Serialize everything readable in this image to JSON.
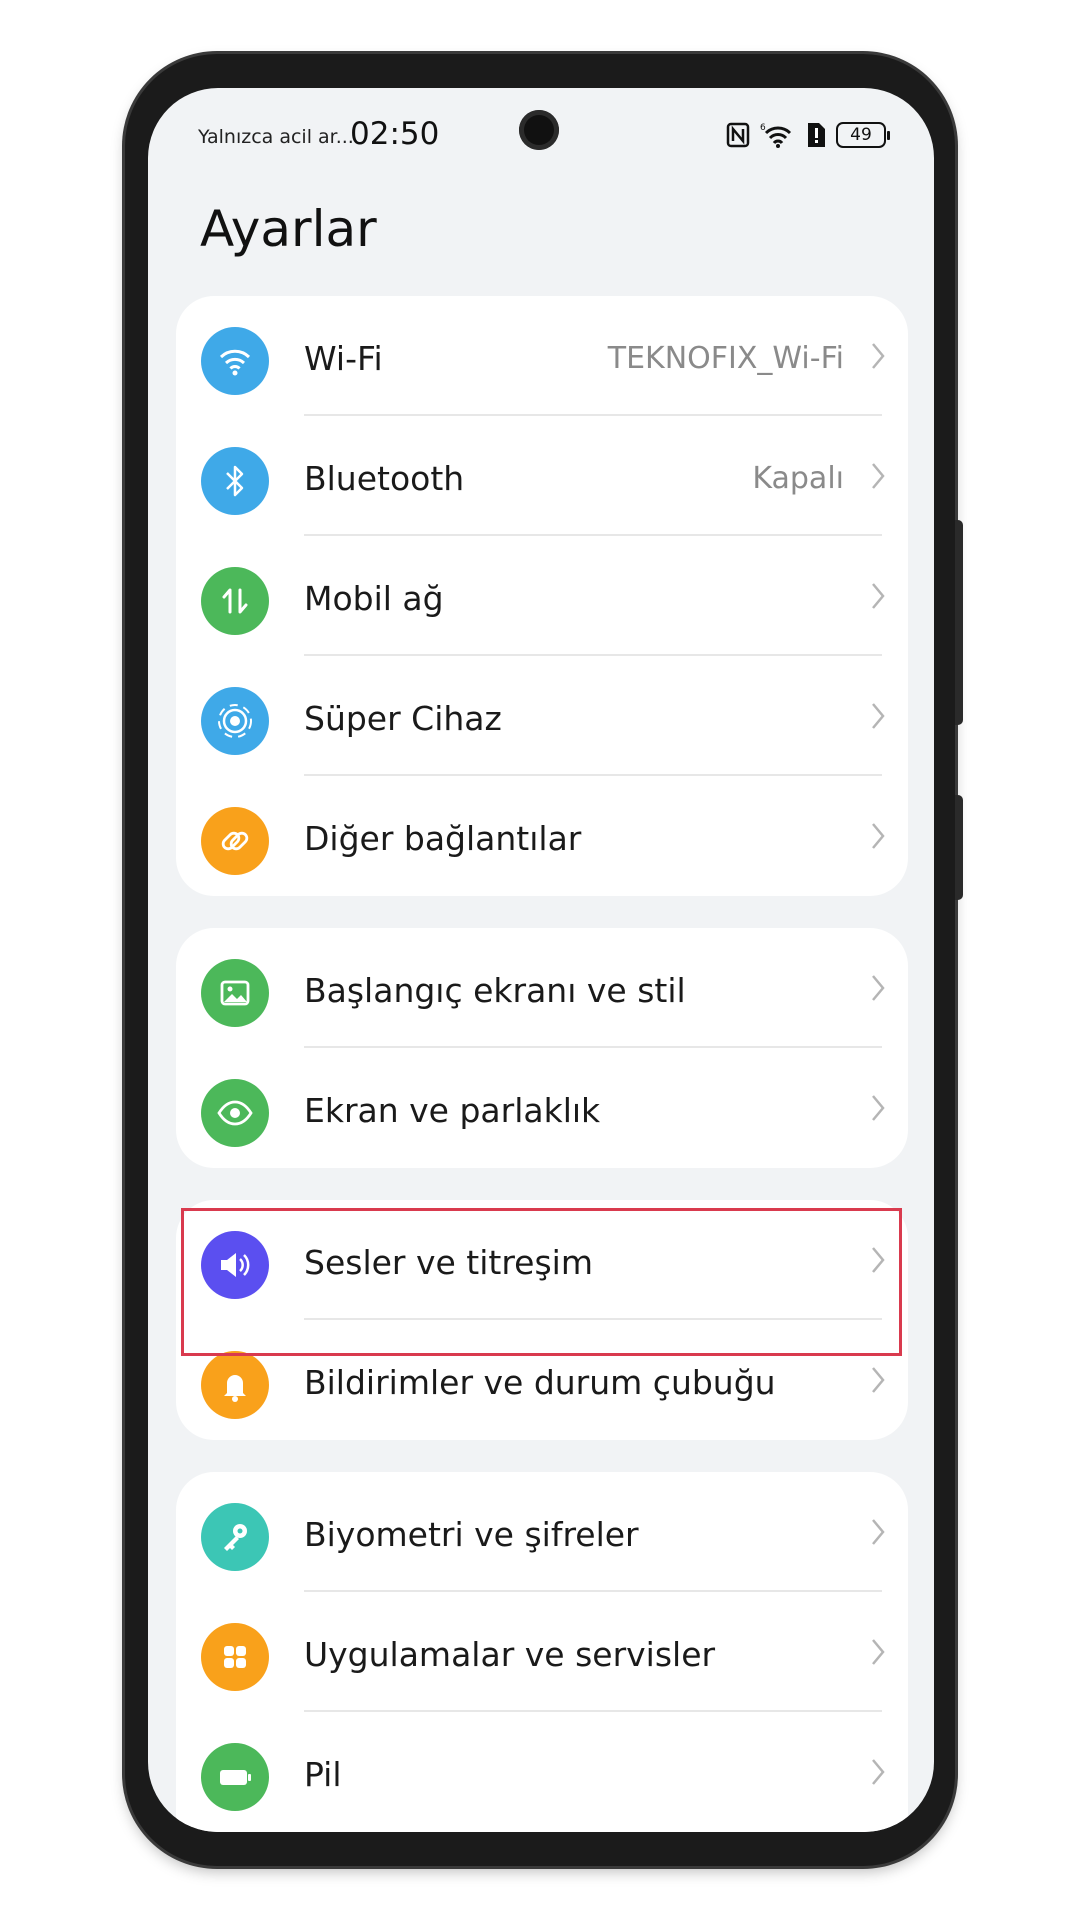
{
  "status_bar": {
    "carrier": "Yalnızca acil ar...",
    "time": "02:50",
    "battery": "49"
  },
  "page_title": "Ayarlar",
  "groups": [
    {
      "items": [
        {
          "label": "Wi-Fi",
          "value": "TEKNOFIX_Wi-Fi",
          "icon": "wifi-icon",
          "color": "#3fa9e8"
        },
        {
          "label": "Bluetooth",
          "value": "Kapalı",
          "icon": "bluetooth-icon",
          "color": "#3fa9e8"
        },
        {
          "label": "Mobil ağ",
          "icon": "mobile-data-icon",
          "color": "#4cb85a"
        },
        {
          "label": "Süper Cihaz",
          "icon": "super-device-icon",
          "color": "#3fa9e8"
        },
        {
          "label": "Diğer bağlantılar",
          "icon": "link-icon",
          "color": "#f9a11b"
        }
      ]
    },
    {
      "items": [
        {
          "label": "Başlangıç ekranı ve stil",
          "icon": "image-icon",
          "color": "#4cb85a"
        },
        {
          "label": "Ekran ve parlaklık",
          "icon": "eye-icon",
          "color": "#4cb85a"
        }
      ]
    },
    {
      "items": [
        {
          "label": "Sesler ve titreşim",
          "icon": "speaker-icon",
          "color": "#5b4ff0"
        },
        {
          "label": "Bildirimler ve durum çubuğu",
          "icon": "bell-icon",
          "color": "#f9a11b"
        }
      ]
    },
    {
      "items": [
        {
          "label": "Biyometri ve şifreler",
          "icon": "key-icon",
          "color": "#3cc6b5"
        },
        {
          "label": "Uygulamalar ve servisler",
          "icon": "apps-icon",
          "color": "#f9a11b"
        },
        {
          "label": "Pil",
          "icon": "battery-icon",
          "color": "#4cb85a"
        }
      ]
    }
  ],
  "highlight_color": "#d93a4e"
}
